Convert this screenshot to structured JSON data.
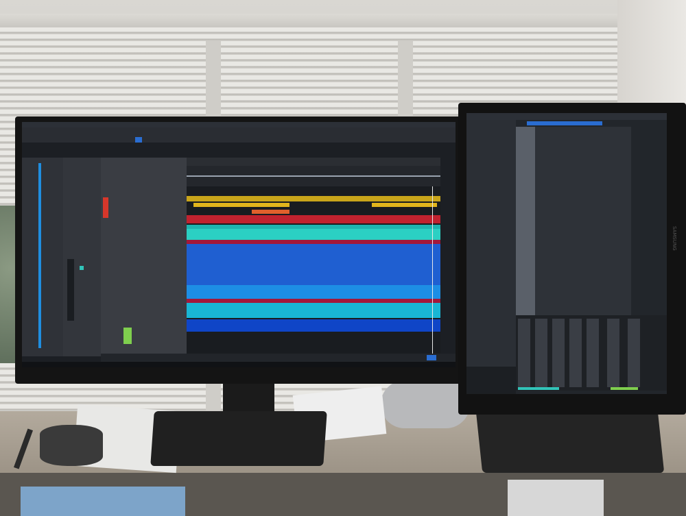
{
  "scene": {
    "description_colors": {
      "wall": "#d9d7d2",
      "desk": "#b3aa9d",
      "monitor_bezel": "#141414"
    }
  },
  "left_monitor": {
    "app": "daw-arrangement-view",
    "lane_colors": [
      "#c9a51a",
      "#e2b51c",
      "#d7372b",
      "#a3183a",
      "#1fb4b0",
      "#2bd0c3",
      "#1a7ce0",
      "#1f5fd1",
      "#1d8ee5",
      "#19b6d4",
      "#0f45c7"
    ]
  },
  "right_monitor": {
    "app": "daw-mixer-console",
    "brand": "SAMSUNG",
    "accent": "#2a6dd1"
  }
}
